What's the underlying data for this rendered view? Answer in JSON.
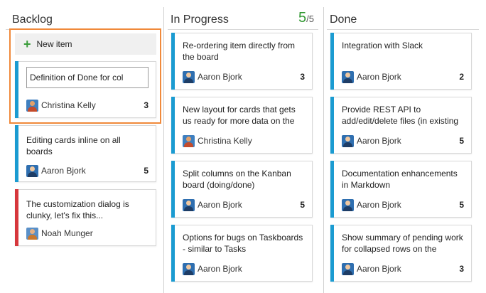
{
  "columns": {
    "backlog": {
      "header": "Backlog"
    },
    "in_progress": {
      "header": "In Progress",
      "wip_current": "5",
      "wip_max": "/5"
    },
    "done": {
      "header": "Done"
    }
  },
  "new_item_label": "New item",
  "colors": {
    "blue_stripe": "#1b9bd1",
    "red_stripe": "#d6373c",
    "selection": "#f0893a",
    "wip_ok": "#339933"
  },
  "backlog_cards": [
    {
      "title": "Definition of Done for col",
      "assignee": "Christina Kelly",
      "effort": "3",
      "editing": true
    },
    {
      "title": "Editing cards inline on all boards",
      "assignee": "Aaron Bjork",
      "effort": "5"
    },
    {
      "title": "The customization dialog is clunky, let's fix this...",
      "assignee": "Noah Munger",
      "effort": ""
    }
  ],
  "in_progress_cards": [
    {
      "title": "Re-ordering item directly from the board",
      "assignee": "Aaron Bjork",
      "effort": "3"
    },
    {
      "title": "New layout for cards that gets us ready for more data on the cards",
      "assignee": "Christina Kelly",
      "effort": ""
    },
    {
      "title": "Split columns on the Kanban board (doing/done)",
      "assignee": "Aaron Bjork",
      "effort": "5"
    },
    {
      "title": "Options for bugs on Taskboards - similar to Tasks",
      "assignee": "Aaron Bjork",
      "effort": ""
    }
  ],
  "done_cards": [
    {
      "title": "Integration with Slack",
      "assignee": "Aaron Bjork",
      "effort": "2"
    },
    {
      "title": "Provide REST API to add/edit/delete files (in existing",
      "assignee": "Aaron Bjork",
      "effort": "5"
    },
    {
      "title": "Documentation enhancements in Markdown",
      "assignee": "Aaron Bjork",
      "effort": "5"
    },
    {
      "title": "Show summary of pending work for collapsed rows on the",
      "assignee": "Aaron Bjork",
      "effort": "3"
    }
  ]
}
